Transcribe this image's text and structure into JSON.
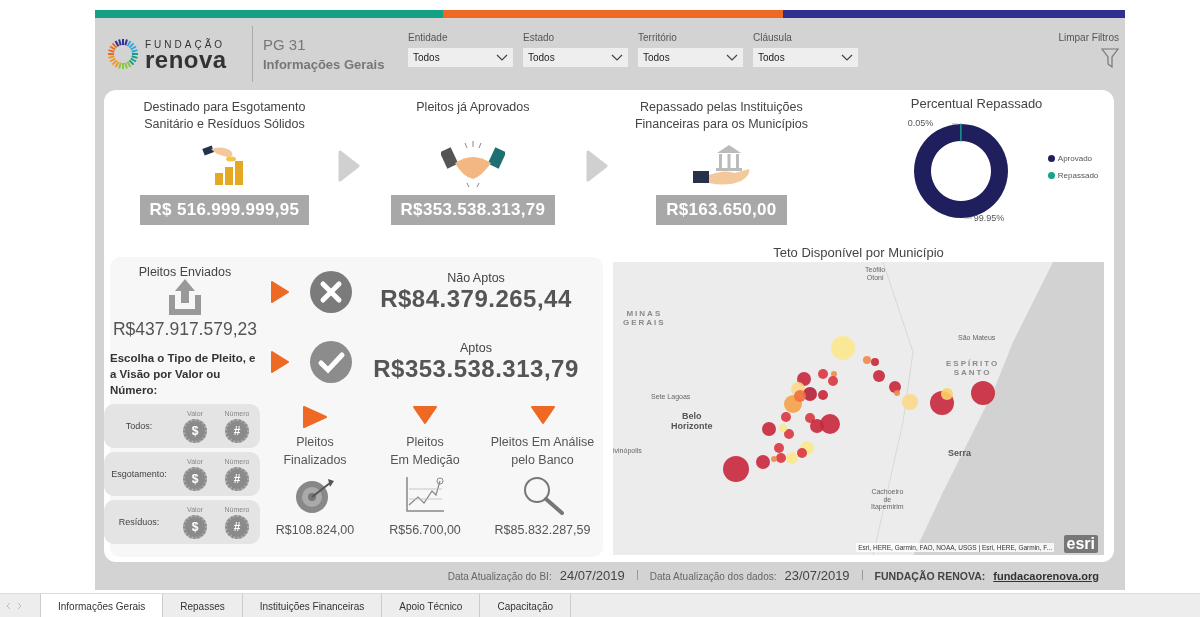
{
  "header": {
    "logo": {
      "line1": "FUNDAÇÃO",
      "line2": "renova"
    },
    "page_code": "PG 31",
    "page_title": "Informações Gerais",
    "filters": [
      {
        "label": "Entidade",
        "value": "Todos"
      },
      {
        "label": "Estado",
        "value": "Todos"
      },
      {
        "label": "Território",
        "value": "Todos"
      },
      {
        "label": "Cláusula",
        "value": "Todos"
      }
    ],
    "clear_filters": "Limpar Filtros"
  },
  "summary": {
    "kpis": [
      {
        "kind": "coins",
        "title": "Destinado para Esgotamento\nSanitário e Resíduos Sólidos",
        "value": "R$ 516.999.999,95"
      },
      {
        "kind": "handshake",
        "title": "Pleitos já Aprovados",
        "value": "R$353.538.313,79"
      },
      {
        "kind": "bank",
        "title": "Repassado pelas Instituições\nFinanceiras para os Municípios",
        "value": "R$163.650,00"
      }
    ],
    "donut": {
      "title": "Percentual Repassado",
      "slices": [
        {
          "color": "#1f1f5e"
        },
        {
          "color": "#12a58a"
        }
      ],
      "chart_data": {
        "type": "donut",
        "categories": [
          "Aprovado",
          "Repassado"
        ],
        "values": [
          99.95,
          0.05
        ],
        "value_labels": [
          "99.95%",
          "0.05%"
        ]
      }
    }
  },
  "pleitos": {
    "sent": {
      "title": "Pleitos Enviados",
      "value": "R$437.917.579,23"
    },
    "prompt": "Escolha o Tipo de Pleito, e a Visão por Valor ou Número:",
    "toggles": [
      {
        "label": "Todos:",
        "value_header": "Valor",
        "number_header": "Número",
        "value_symbol": "$",
        "number_symbol": "#"
      },
      {
        "label": "Esgotamento:",
        "value_header": "Valor",
        "number_header": "Número",
        "value_symbol": "$",
        "number_symbol": "#"
      },
      {
        "label": "Resíduos:",
        "value_header": "Valor",
        "number_header": "Número",
        "value_symbol": "$",
        "number_symbol": "#"
      }
    ],
    "outcomes": [
      {
        "kind": "rejected",
        "title": "Não Aptos",
        "value": "R$84.379.265,44"
      },
      {
        "kind": "approved",
        "title": "Aptos",
        "value": "R$353.538.313,79"
      }
    ],
    "stages": [
      {
        "kind": "finished",
        "title": "Pleitos\nFinalizados",
        "value": "R$108.824,00"
      },
      {
        "kind": "measuring",
        "title": "Pleitos\nEm Medição",
        "value": "R$56.700,00"
      },
      {
        "kind": "analysis",
        "title": "Pleitos Em Análise\npelo Banco",
        "value": "R$85.832.287,59"
      }
    ]
  },
  "map": {
    "title": "Teto Disponível por Município",
    "labels": [
      {
        "kind": "city",
        "text": "Teófilo\nOtoni"
      },
      {
        "kind": "region",
        "text": "MINAS\nGERAIS"
      },
      {
        "kind": "city",
        "text": "São Mateus"
      },
      {
        "kind": "region",
        "text": "ESPÍRITO\nSANTO"
      },
      {
        "kind": "city",
        "text": "Sete Lagoas"
      },
      {
        "kind": "capital",
        "text": "Belo\nHorizonte"
      },
      {
        "kind": "city",
        "text": "ivinópolis"
      },
      {
        "kind": "capital",
        "text": "Serra"
      },
      {
        "kind": "city",
        "text": "Cachoeiro\nde\nItapemirim"
      }
    ],
    "attribution": "Esri, HERE, Garmin, FAO, NOAA, USGS | Esri, HERE, Garmin, F...",
    "logo": "esri"
  },
  "footer": {
    "bi_label": "Data Atualização do BI:",
    "bi_date": "24/07/2019",
    "data_label": "Data Atualização dos dados:",
    "data_date": "23/07/2019",
    "org_label": "FUNDAÇÃO RENOVA:",
    "link": "fundacaorenova.org"
  },
  "tabs": [
    {
      "label": "Informações Gerais",
      "selected": true
    },
    {
      "label": "Repasses",
      "selected": false
    },
    {
      "label": "Instituições Financeiras",
      "selected": false
    },
    {
      "label": "Apoio Técnico",
      "selected": false
    },
    {
      "label": "Capacitação",
      "selected": false
    }
  ]
}
